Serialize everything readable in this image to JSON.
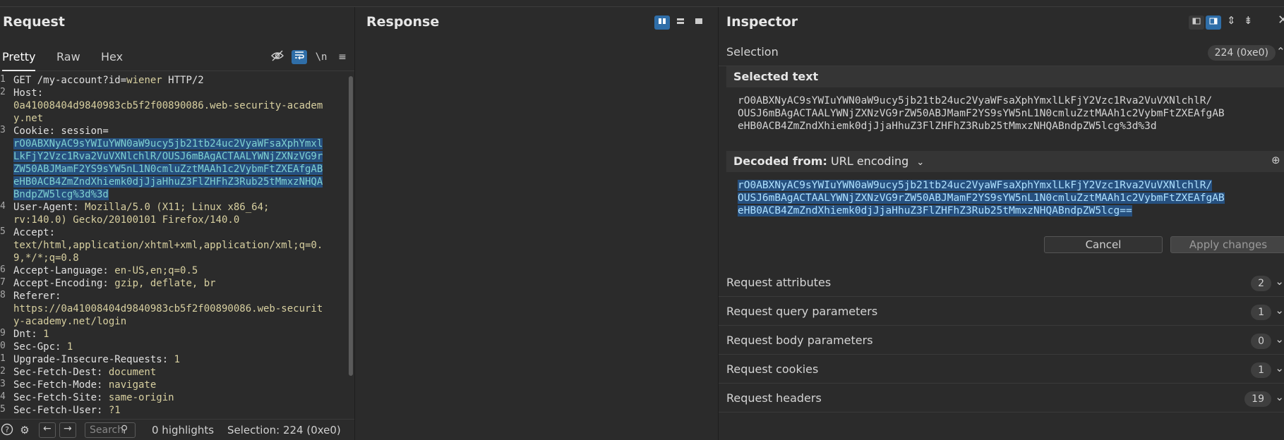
{
  "request": {
    "title": "Request",
    "tabs": [
      "Pretty",
      "Raw",
      "Hex"
    ],
    "tools": {
      "hide_icon": "eye-slash-icon",
      "wrap_icon": "wrap-icon",
      "newline_label": "\\n",
      "menu_icon": "menu-icon"
    },
    "lines": [
      {
        "n": "1",
        "parts": [
          {
            "t": "GET /my-account?id=",
            "c": "hk"
          },
          {
            "t": "wiener",
            "c": "hv"
          },
          {
            "t": " HTTP/2",
            "c": "hk"
          }
        ]
      },
      {
        "n": "2",
        "parts": [
          {
            "t": "Host:",
            "c": "hk"
          }
        ]
      },
      {
        "n": "",
        "parts": [
          {
            "t": "0a41008404d9840983cb5f2f00890086.web-security-academ",
            "c": "hv"
          }
        ]
      },
      {
        "n": "",
        "parts": [
          {
            "t": "y.net",
            "c": "hv"
          }
        ]
      },
      {
        "n": "3",
        "parts": [
          {
            "t": "Cookie: session=",
            "c": "hk"
          }
        ]
      },
      {
        "n": "",
        "parts": [
          {
            "t": "rO0ABXNyAC9sYWIuYWN0aW9ucy5jb21tb24uc2VyaWFsaXphYmxl",
            "c": "sel"
          }
        ]
      },
      {
        "n": "",
        "parts": [
          {
            "t": "LkFjY2Vzc1Rva2VuVXNlchlR/OUSJ6mBAgACTAALYWNjZXNzVG9r",
            "c": "sel"
          }
        ]
      },
      {
        "n": "",
        "parts": [
          {
            "t": "ZW50ABJMamF2YS9sYW5nL1N0cmluZztMAAh1c2VybmFtZXEAfgAB",
            "c": "sel"
          }
        ]
      },
      {
        "n": "",
        "parts": [
          {
            "t": "eHB0ACB4ZmZndXhiemk0djJjaHhuZ3FlZHFhZ3Rub25tMmxzNHQA",
            "c": "sel"
          }
        ]
      },
      {
        "n": "",
        "parts": [
          {
            "t": "BndpZW5lcg%3d%3d",
            "c": "sel"
          }
        ]
      },
      {
        "n": "4",
        "parts": [
          {
            "t": "User-Agent: ",
            "c": "hk"
          },
          {
            "t": "Mozilla/5.0 (X11; Linux x86_64;",
            "c": "hv"
          }
        ]
      },
      {
        "n": "",
        "parts": [
          {
            "t": "rv:140.0) Gecko/20100101 Firefox/140.0",
            "c": "hv"
          }
        ]
      },
      {
        "n": "5",
        "parts": [
          {
            "t": "Accept:",
            "c": "hk"
          }
        ]
      },
      {
        "n": "",
        "parts": [
          {
            "t": "text/html,application/xhtml+xml,application/xml;q=0.",
            "c": "hv"
          }
        ]
      },
      {
        "n": "",
        "parts": [
          {
            "t": "9,*/*;q=0.8",
            "c": "hv"
          }
        ]
      },
      {
        "n": "6",
        "parts": [
          {
            "t": "Accept-Language: ",
            "c": "hk"
          },
          {
            "t": "en-US,en;q=0.5",
            "c": "hv"
          }
        ]
      },
      {
        "n": "7",
        "parts": [
          {
            "t": "Accept-Encoding: ",
            "c": "hk"
          },
          {
            "t": "gzip, deflate, br",
            "c": "hv"
          }
        ]
      },
      {
        "n": "8",
        "parts": [
          {
            "t": "Referer:",
            "c": "hk"
          }
        ]
      },
      {
        "n": "",
        "parts": [
          {
            "t": "https://0a41008404d9840983cb5f2f00890086.web-securit",
            "c": "hv"
          }
        ]
      },
      {
        "n": "",
        "parts": [
          {
            "t": "y-academy.net/login",
            "c": "hv"
          }
        ]
      },
      {
        "n": "9",
        "parts": [
          {
            "t": "Dnt: ",
            "c": "hk"
          },
          {
            "t": "1",
            "c": "hv"
          }
        ]
      },
      {
        "n": "0",
        "parts": [
          {
            "t": "Sec-Gpc: ",
            "c": "hk"
          },
          {
            "t": "1",
            "c": "hv"
          }
        ]
      },
      {
        "n": "1",
        "parts": [
          {
            "t": "Upgrade-Insecure-Requests: ",
            "c": "hk"
          },
          {
            "t": "1",
            "c": "hv"
          }
        ]
      },
      {
        "n": "2",
        "parts": [
          {
            "t": "Sec-Fetch-Dest: ",
            "c": "hk"
          },
          {
            "t": "document",
            "c": "hv"
          }
        ]
      },
      {
        "n": "3",
        "parts": [
          {
            "t": "Sec-Fetch-Mode: ",
            "c": "hk"
          },
          {
            "t": "navigate",
            "c": "hv"
          }
        ]
      },
      {
        "n": "4",
        "parts": [
          {
            "t": "Sec-Fetch-Site: ",
            "c": "hk"
          },
          {
            "t": "same-origin",
            "c": "hv"
          }
        ]
      },
      {
        "n": "5",
        "parts": [
          {
            "t": "Sec-Fetch-User: ",
            "c": "hk"
          },
          {
            "t": "?1",
            "c": "hv"
          }
        ]
      }
    ],
    "status": {
      "search_placeholder": "Search",
      "highlights": "0 highlights",
      "selection": "Selection: 224 (0xe0)"
    }
  },
  "response": {
    "title": "Response"
  },
  "inspector": {
    "title": "Inspector",
    "selection_label": "Selection",
    "selection_badge": "224 (0xe0)",
    "selected_text_label": "Selected text",
    "selected_text": "rO0ABXNyAC9sYWIuYWN0aW9ucy5jb21tb24uc2VyaWFsaXphYmxlLkFjY2Vzc1Rva2VuVXNlchlR/\nOUSJ6mBAgACTAALYWNjZXNzVG9rZW50ABJMamF2YS9sYW5nL1N0cmluZztMAAh1c2VybmFtZXEAfgAB\neHB0ACB4ZmZndXhiemk0djJjaHhuZ3FlZHFhZ3Rub25tMmxzNHQABndpZW5lcg%3d%3d",
    "decoded_from_label": "Decoded from:",
    "decoded_from_value": "URL encoding",
    "decoded_lines": [
      "rO0ABXNyAC9sYWIuYWN0aW9ucy5jb21tb24uc2VyaWFsaXphYmxlLkFjY2Vzc1Rva2VuVXNlchlR/",
      "OUSJ6mBAgACTAALYWNjZXNzVG9rZW50ABJMamF2YS9sYW5nL1N0cmluZztMAAh1c2VybmFtZXEAfgAB",
      "eHB0ACB4ZmZndXhiemk0djJjaHhuZ3FlZHFhZ3Rub25tMmxzNHQABndpZW5lcg=="
    ],
    "cancel_label": "Cancel",
    "apply_label": "Apply changes",
    "sections": [
      {
        "label": "Request attributes",
        "count": "2"
      },
      {
        "label": "Request query parameters",
        "count": "1"
      },
      {
        "label": "Request body parameters",
        "count": "0"
      },
      {
        "label": "Request cookies",
        "count": "1"
      },
      {
        "label": "Request headers",
        "count": "19"
      }
    ]
  }
}
